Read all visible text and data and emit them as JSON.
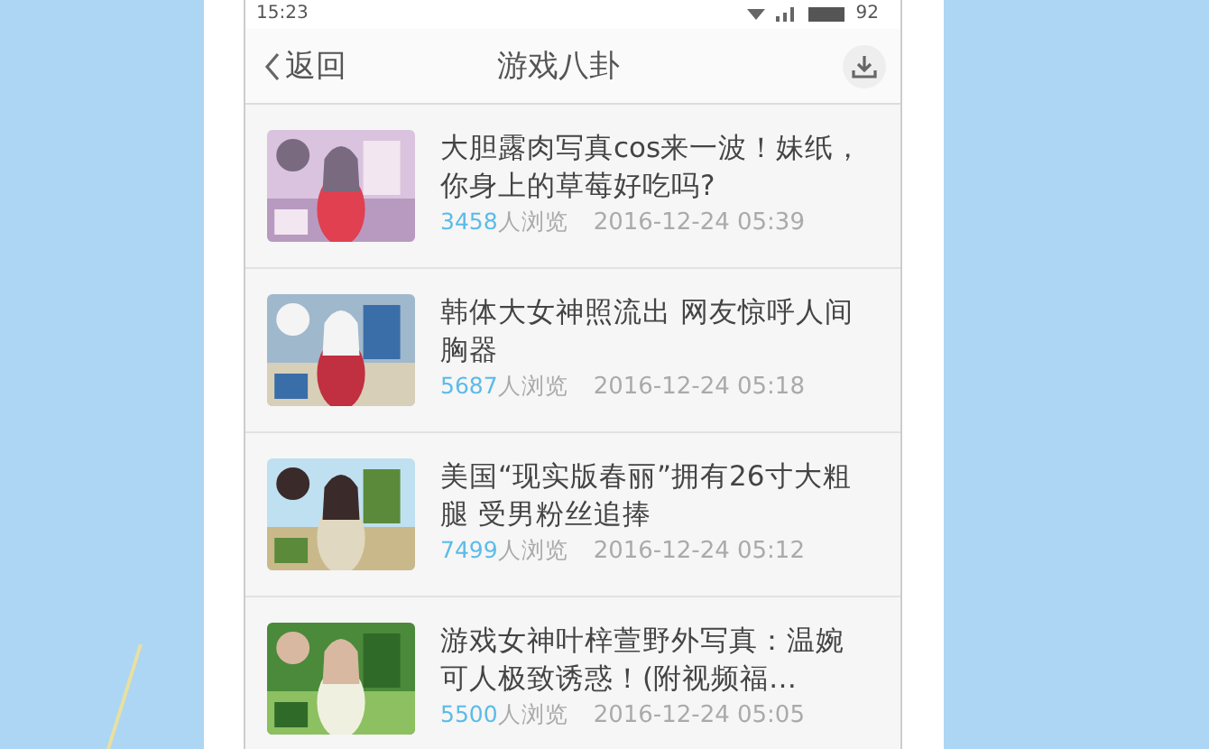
{
  "status_bar": {
    "time": "15:23",
    "battery": "92"
  },
  "header": {
    "back": "返回",
    "title": "游戏八卦"
  },
  "articles": [
    {
      "title": "大胆露肉写真cos来一波！妹纸，你身上的草莓好吃吗?",
      "views": "3458",
      "views_label": "人浏览",
      "time": "2016-12-24 05:39"
    },
    {
      "title": "韩体大女神照流出 网友惊呼人间胸器",
      "views": "5687",
      "views_label": "人浏览",
      "time": "2016-12-24 05:18"
    },
    {
      "title": "美国“现实版春丽”拥有26寸大粗腿 受男粉丝追捧",
      "views": "7499",
      "views_label": "人浏览",
      "time": "2016-12-24 05:12"
    },
    {
      "title": "游戏女神叶梓萱野外写真：温婉可人极致诱惑！(附视频福…",
      "views": "5500",
      "views_label": "人浏览",
      "time": "2016-12-24 05:05"
    }
  ]
}
